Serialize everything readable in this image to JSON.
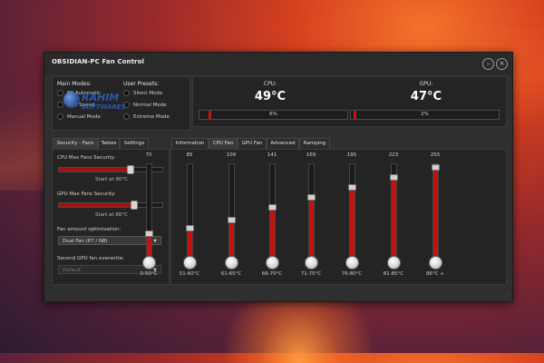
{
  "window": {
    "title": "OBSIDIAN-PC Fan Control",
    "minimize_glyph": "–",
    "close_glyph": "×"
  },
  "modes": {
    "main_title": "Main Modes:",
    "user_title": "User Presets:",
    "main_items": [
      "PC Automatic",
      "Max Speed",
      "Manual Mode"
    ],
    "user_items": [
      "Silent Mode",
      "Normal Mode",
      "Extreme Mode"
    ]
  },
  "watermark": {
    "brand": "RAHIM",
    "sub": "SOFTWARES"
  },
  "temps": {
    "cpu_label": "CPU:",
    "cpu_value": "49°C",
    "cpu_percent_text": "6%",
    "cpu_percent": 6,
    "gpu_label": "GPU:",
    "gpu_value": "47°C",
    "gpu_percent_text": "2%",
    "gpu_percent": 2,
    "accent": "#c8140f"
  },
  "left_tabs": [
    "Security - Fans",
    "Tables",
    "Settings"
  ],
  "security": {
    "cpu_label": "CPU Max Fans Security:",
    "cpu_slider": 0.68,
    "cpu_hint": "Start at 90°C",
    "gpu_label": "GPU Max Fans Security:",
    "gpu_slider": 0.72,
    "gpu_hint": "Start at 86°C",
    "fan_opt_label": "Fan amount optimization:",
    "fan_opt_value": "Dual Fan (P7 / N8)",
    "second_gpu_label": "Second GPU fan overwrite:",
    "second_gpu_value": "Default"
  },
  "right_tabs": [
    "Information",
    "CPU Fan",
    "GPU Fan",
    "Advanced",
    "Ramping"
  ],
  "fans": [
    {
      "value": "70",
      "range": "0-50°C",
      "level": 70
    },
    {
      "value": "85",
      "range": "51-60°C",
      "level": 85
    },
    {
      "value": "109",
      "range": "61-65°C",
      "level": 109
    },
    {
      "value": "141",
      "range": "66-70°C",
      "level": 141
    },
    {
      "value": "169",
      "range": "71-75°C",
      "level": 169
    },
    {
      "value": "195",
      "range": "76-80°C",
      "level": 195
    },
    {
      "value": "223",
      "range": "81-85°C",
      "level": 223
    },
    {
      "value": "255",
      "range": "86°C +",
      "level": 255
    }
  ],
  "fan_max": 255
}
